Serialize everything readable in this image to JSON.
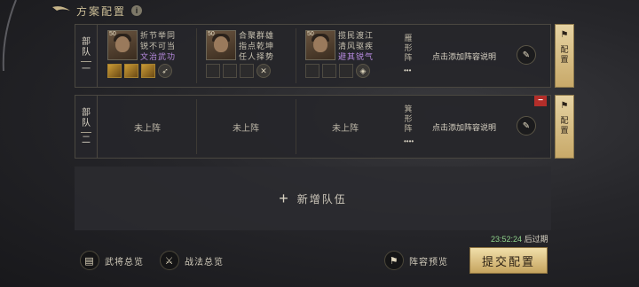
{
  "header": {
    "title": "方案配置",
    "info_symbol": "i"
  },
  "teams": [
    {
      "label_top": "部",
      "label_bottom": "队一",
      "label_chars": [
        "部",
        "队",
        "一"
      ],
      "heroes": [
        {
          "level": "50",
          "lines": [
            "折节举同",
            "锐不可当"
          ],
          "tag": "文治武功"
        },
        {
          "level": "50",
          "lines": [
            "合聚群雄",
            "指点乾坤"
          ],
          "tag": "任人择势"
        },
        {
          "level": "50",
          "lines": [
            "揽民渡江",
            "清风驱疾"
          ],
          "tag": "避其锐气"
        }
      ],
      "formation": [
        "雁",
        "形",
        "阵"
      ],
      "formation_symbol": "•••",
      "note": "点击添加阵容说明",
      "config_label": [
        "配",
        "置"
      ]
    },
    {
      "label_chars": [
        "部",
        "队",
        "二"
      ],
      "slots": [
        "未上阵",
        "未上阵",
        "未上阵"
      ],
      "formation": [
        "箕",
        "形",
        "阵"
      ],
      "formation_symbol": "••••",
      "note": "点击添加阵容说明",
      "config_label": [
        "配",
        "置"
      ],
      "remove_symbol": "−"
    }
  ],
  "add_team": {
    "plus": "+",
    "label": "新增队伍"
  },
  "deadline": {
    "time": "23:52:24",
    "suffix": "后过期"
  },
  "bottom": {
    "generals": "武将总览",
    "tactics": "战法总览",
    "preview": "阵容预览",
    "submit": "提交配置"
  },
  "colors": {
    "accent_gold": "#c8a969",
    "purple_tag": "#b88be0",
    "timer_green": "#8fd38b",
    "remove_red": "#b32e2a"
  }
}
